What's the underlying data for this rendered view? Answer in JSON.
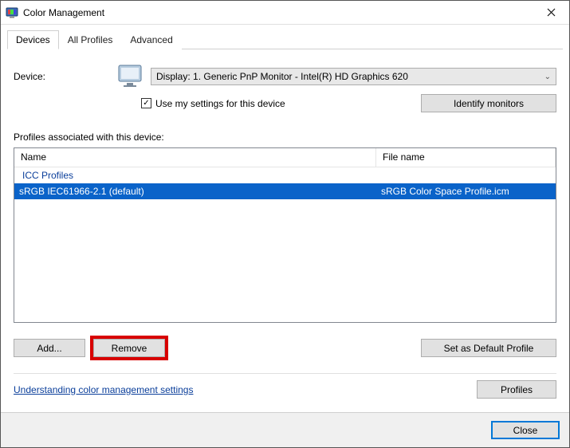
{
  "window": {
    "title": "Color Management"
  },
  "tabs": {
    "devices": "Devices",
    "all_profiles": "All Profiles",
    "advanced": "Advanced"
  },
  "labels": {
    "device": "Device:",
    "use_my_settings": "Use my settings for this device",
    "identify": "Identify monitors",
    "profiles_assoc": "Profiles associated with this device:",
    "col_name": "Name",
    "col_file": "File name",
    "group_icc": "ICC Profiles",
    "add": "Add...",
    "remove": "Remove",
    "set_default": "Set as Default Profile",
    "understanding": "Understanding color management settings",
    "profiles_btn": "Profiles",
    "close": "Close"
  },
  "device_select": {
    "value": "Display: 1. Generic PnP Monitor - Intel(R) HD Graphics 620"
  },
  "checkbox": {
    "checked_glyph": "✓"
  },
  "profile_row": {
    "name": "sRGB IEC61966-2.1 (default)",
    "file": "sRGB Color Space Profile.icm"
  }
}
